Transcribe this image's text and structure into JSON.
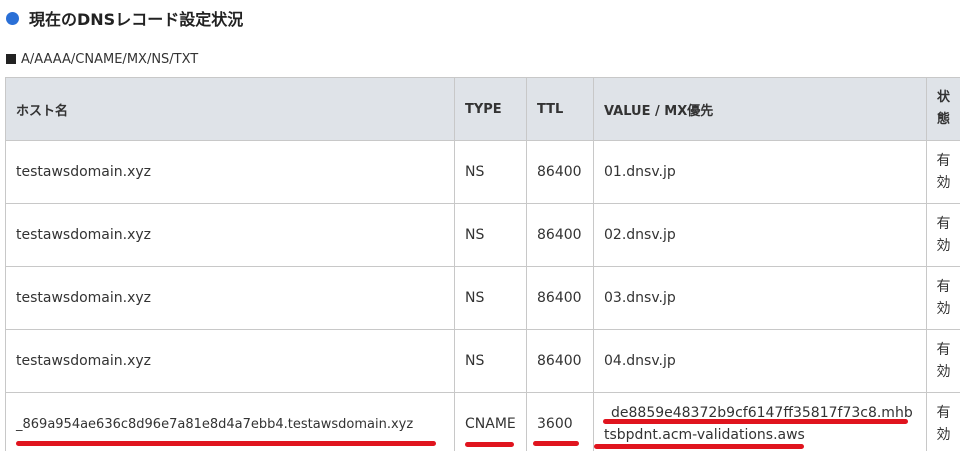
{
  "section": {
    "title": "現在のDNSレコード設定状況",
    "subtitle": "A/AAAA/CNAME/MX/NS/TXT"
  },
  "table": {
    "headers": {
      "host": "ホスト名",
      "type": "TYPE",
      "ttl": "TTL",
      "value": "VALUE / MX優先",
      "state": "状態"
    },
    "rows": [
      {
        "host": "testawsdomain.xyz",
        "type": "NS",
        "ttl": "86400",
        "value": "01.dnsv.jp",
        "state": "有効"
      },
      {
        "host": "testawsdomain.xyz",
        "type": "NS",
        "ttl": "86400",
        "value": "02.dnsv.jp",
        "state": "有効"
      },
      {
        "host": "testawsdomain.xyz",
        "type": "NS",
        "ttl": "86400",
        "value": "03.dnsv.jp",
        "state": "有効"
      },
      {
        "host": "testawsdomain.xyz",
        "type": "NS",
        "ttl": "86400",
        "value": "04.dnsv.jp",
        "state": "有効"
      },
      {
        "host": "_869a954ae636c8d96e7a81e8d4a7ebb4.testawsdomain.xyz",
        "type": "CNAME",
        "ttl": "3600",
        "value": "_de8859e48372b9cf6147ff35817f73c8.mhbtsbpdnt.acm-validations.aws",
        "state": "有効"
      }
    ]
  },
  "colors": {
    "header_bg": "#dfe3e8",
    "border": "#c8c8c8",
    "accent_dot": "#2a6fd6",
    "annotation_red": "#e0141e"
  }
}
